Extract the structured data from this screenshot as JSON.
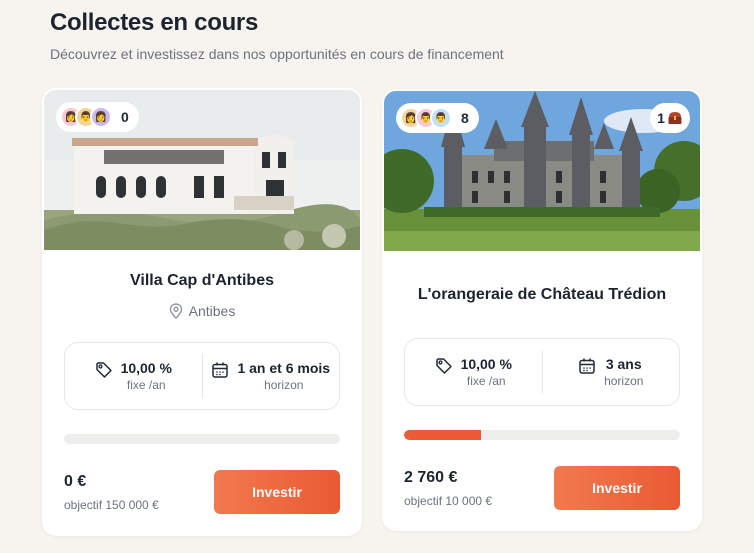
{
  "header": {
    "title": "Collectes en cours",
    "subtitle": "Découvrez et investissez dans nos opportunités en cours de financement"
  },
  "accent_color": "#ec5b36",
  "cards": [
    {
      "investor_count": "0",
      "title": "Villa Cap d'Antibes",
      "location": "Antibes",
      "rate_value": "10,00 %",
      "rate_sub": "fixe /an",
      "horizon_value": "1 an et 6 mois",
      "horizon_sub": "horizon",
      "progress": 0,
      "amount": "0 €",
      "goal": "objectif 150 000 €",
      "button": "Investir"
    },
    {
      "investor_count": "8",
      "badge_count": "1",
      "title": "L'orangeraie de Château Trédion",
      "rate_value": "10,00 %",
      "rate_sub": "fixe /an",
      "horizon_value": "3 ans",
      "horizon_sub": "horizon",
      "progress": 0.28,
      "amount": "2 760 €",
      "goal": "objectif 10 000 €",
      "button": "Investir"
    }
  ]
}
